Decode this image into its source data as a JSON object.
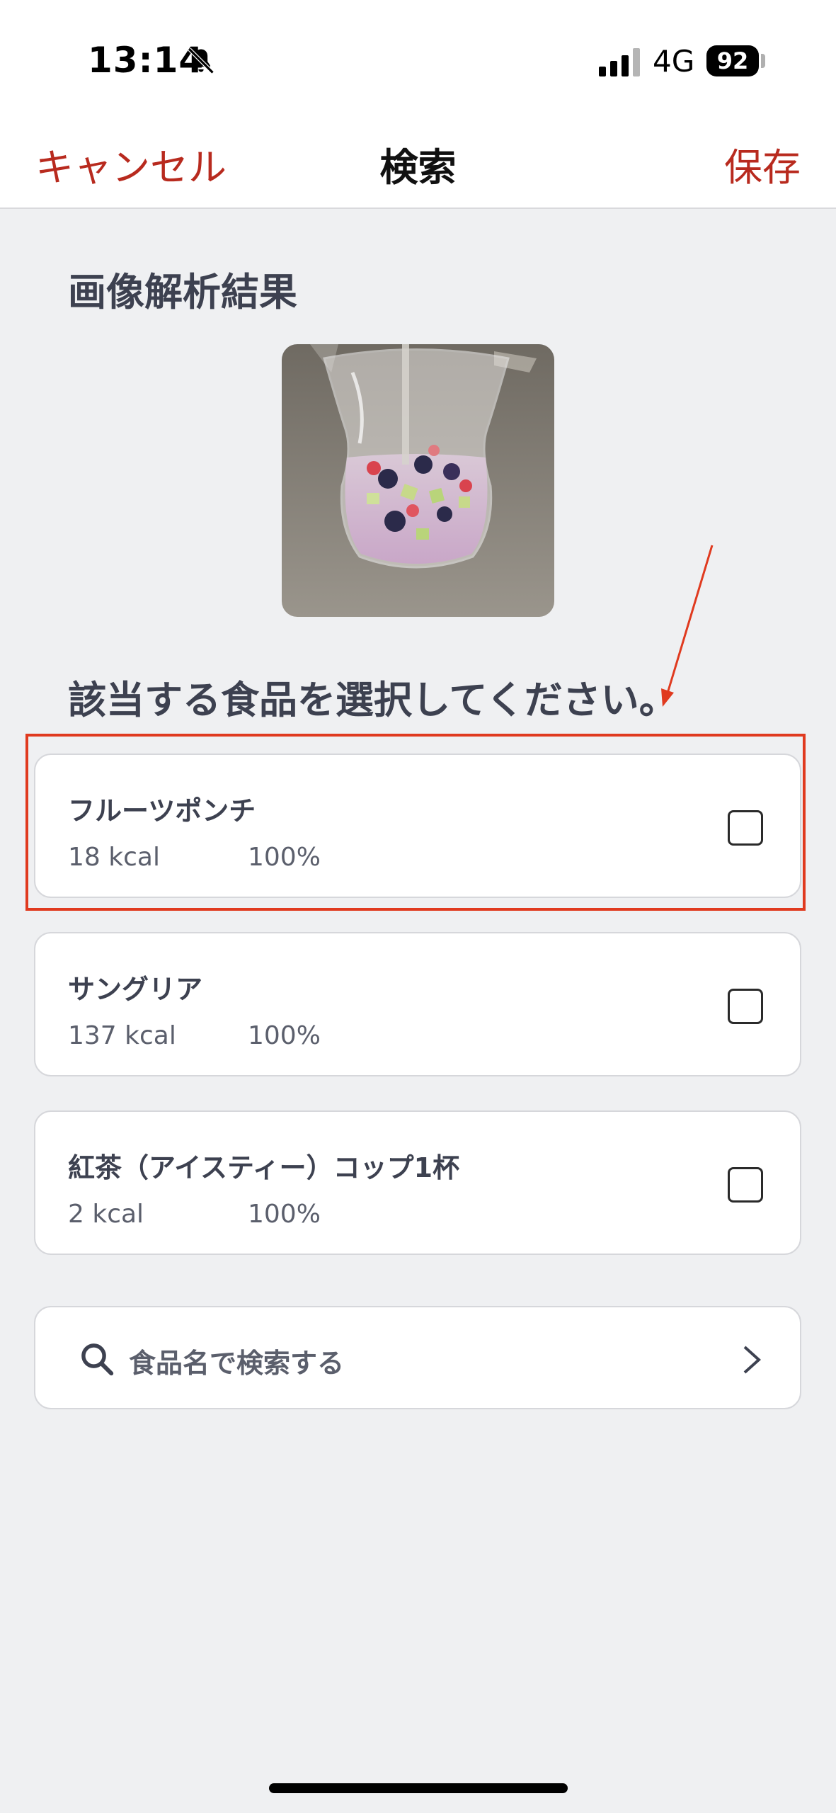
{
  "status_bar": {
    "time": "13:14",
    "network": "4G",
    "battery": "92"
  },
  "nav": {
    "cancel_label": "キャンセル",
    "title": "検索",
    "save_label": "保存"
  },
  "analysis": {
    "heading": "画像解析結果"
  },
  "selection": {
    "heading": "該当する食品を選択してください。",
    "items": [
      {
        "name": "フルーツポンチ",
        "kcal": "18 kcal",
        "percent": "100%",
        "checked": false
      },
      {
        "name": "サングリア",
        "kcal": "137 kcal",
        "percent": "100%",
        "checked": false
      },
      {
        "name": "紅茶（アイスティー）コップ1杯",
        "kcal": "2 kcal",
        "percent": "100%",
        "checked": false
      }
    ]
  },
  "search": {
    "label": "食品名で検索する"
  },
  "colors": {
    "accent": "#b82a1e",
    "highlight": "#e03a1f",
    "background": "#eff0f2"
  }
}
